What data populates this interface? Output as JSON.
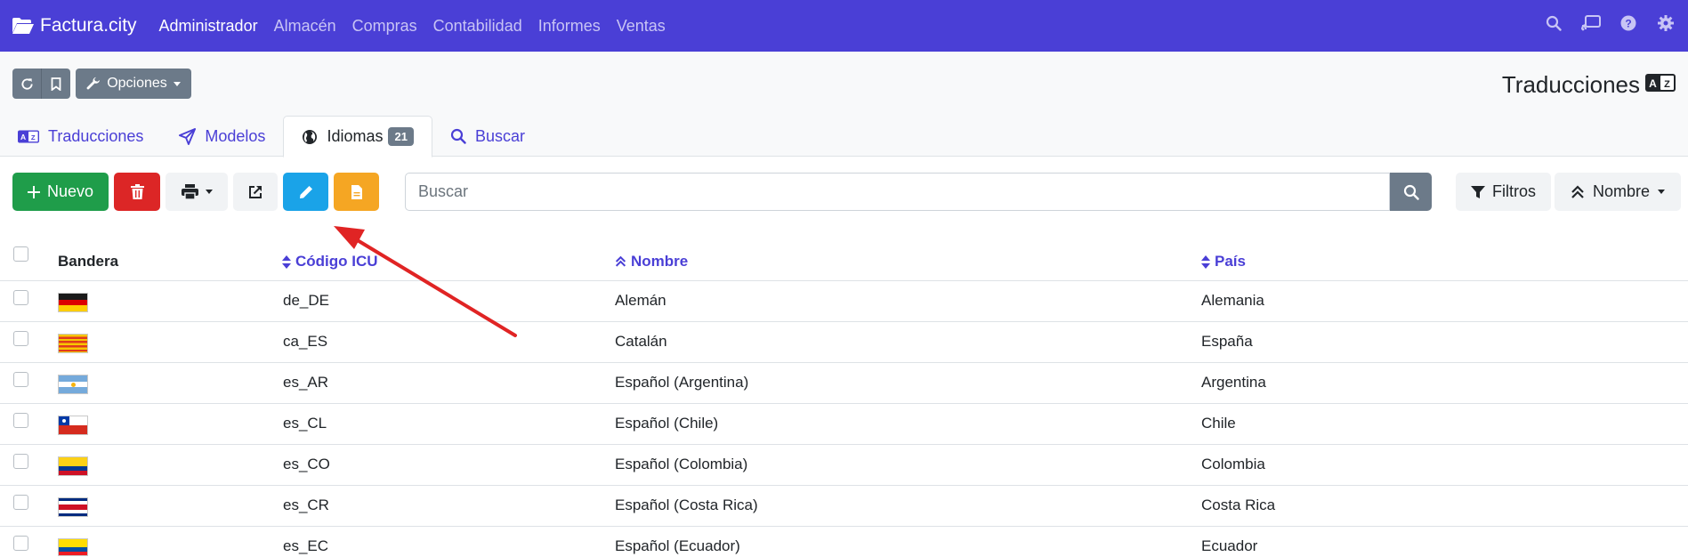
{
  "brand": {
    "name": "Factura.city"
  },
  "nav": {
    "items": [
      {
        "label": "Administrador",
        "active": true
      },
      {
        "label": "Almacén",
        "active": false
      },
      {
        "label": "Compras",
        "active": false
      },
      {
        "label": "Contabilidad",
        "active": false
      },
      {
        "label": "Informes",
        "active": false
      },
      {
        "label": "Ventas",
        "active": false
      }
    ],
    "icons": [
      "search-icon",
      "cast-icon",
      "help-icon",
      "gear-icon"
    ]
  },
  "header": {
    "options_label": "Opciones",
    "page_title": "Traducciones"
  },
  "tabs": [
    {
      "label": "Traducciones",
      "icon": "translate-icon",
      "active": false
    },
    {
      "label": "Modelos",
      "icon": "send-icon",
      "active": false
    },
    {
      "label": "Idiomas",
      "icon": "globe-icon",
      "active": true,
      "badge": "21"
    },
    {
      "label": "Buscar",
      "icon": "search-icon",
      "active": false
    }
  ],
  "toolbar": {
    "new_label": "Nuevo",
    "search_placeholder": "Buscar",
    "filters_label": "Filtros",
    "sort_label": "Nombre"
  },
  "table": {
    "columns": [
      {
        "label": "Bandera",
        "sortable": false
      },
      {
        "label": "Código ICU",
        "sortable": true
      },
      {
        "label": "Nombre",
        "sortable": true,
        "sorted": "asc"
      },
      {
        "label": "País",
        "sortable": true
      }
    ],
    "rows": [
      {
        "flag": "de",
        "code": "de_DE",
        "name": "Alemán",
        "country": "Alemania"
      },
      {
        "flag": "ca",
        "code": "ca_ES",
        "name": "Catalán",
        "country": "España"
      },
      {
        "flag": "ar",
        "code": "es_AR",
        "name": "Español (Argentina)",
        "country": "Argentina"
      },
      {
        "flag": "cl",
        "code": "es_CL",
        "name": "Español (Chile)",
        "country": "Chile"
      },
      {
        "flag": "co",
        "code": "es_CO",
        "name": "Español (Colombia)",
        "country": "Colombia"
      },
      {
        "flag": "cr",
        "code": "es_CR",
        "name": "Español (Costa Rica)",
        "country": "Costa Rica"
      },
      {
        "flag": "ec",
        "code": "es_EC",
        "name": "Español (Ecuador)",
        "country": "Ecuador"
      }
    ]
  },
  "colors": {
    "navbar": "#4a3fd6",
    "accent": "#4a3fd6",
    "success": "#1f9d4a",
    "danger": "#dc2626",
    "info": "#1aa3e8",
    "warning": "#f5a623",
    "annotation_arrow": "#e02424"
  }
}
